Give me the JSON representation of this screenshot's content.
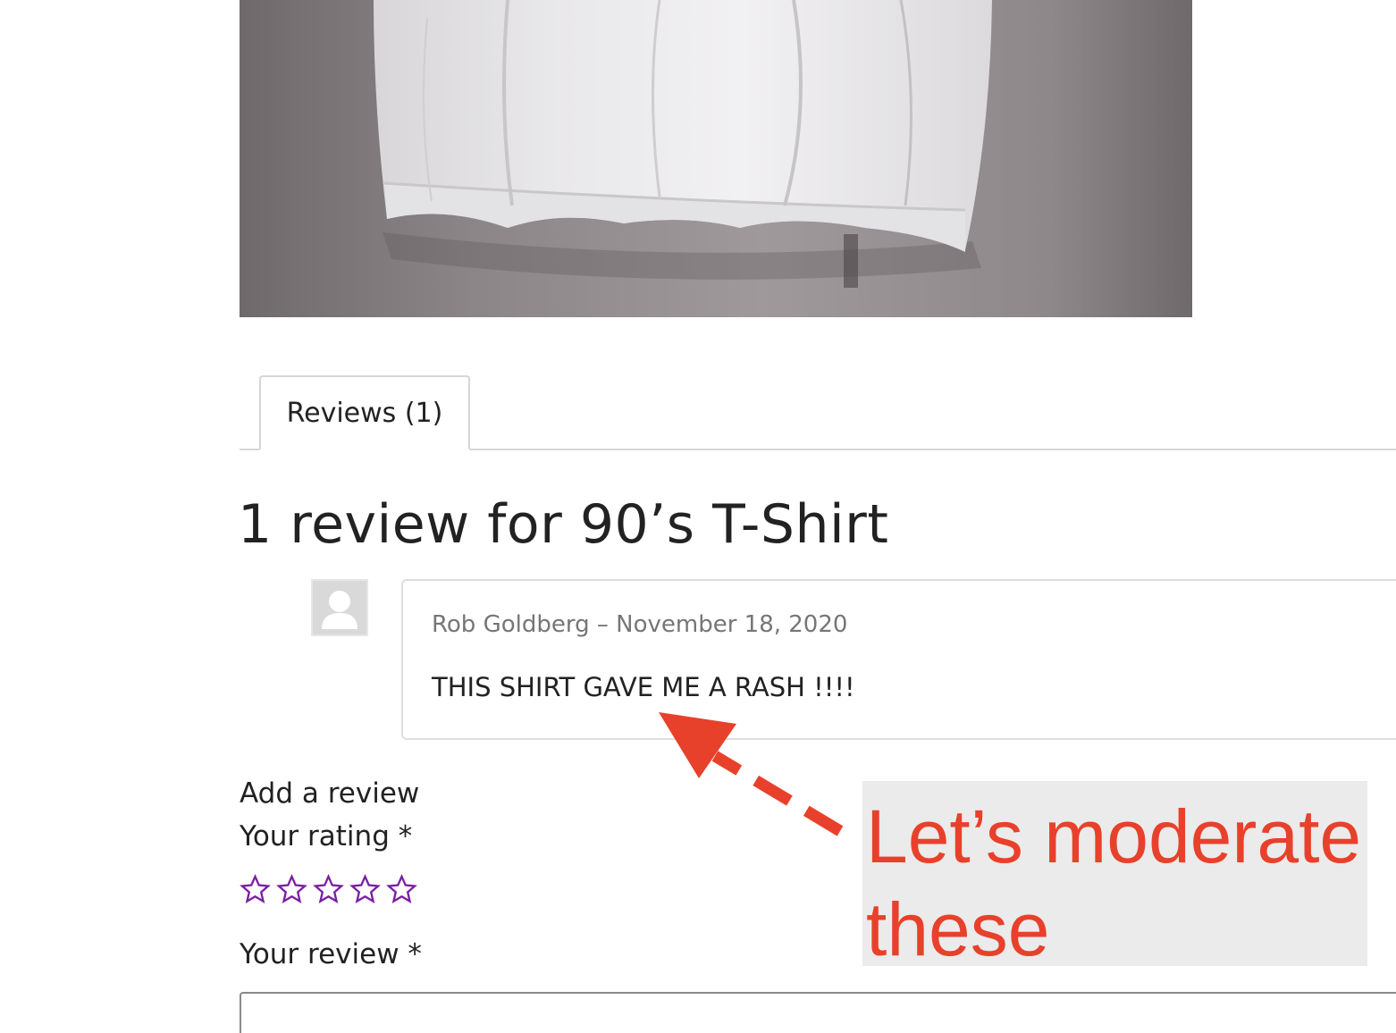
{
  "product_image": {
    "alt": "white t-shirt hanging on wall"
  },
  "tabs": [
    {
      "label": "Reviews (1)",
      "active": true
    }
  ],
  "reviews": {
    "heading": "1 review for 90’s T-Shirt",
    "items": [
      {
        "author": "Rob Goldberg",
        "separator": "–",
        "date": "November 18, 2020",
        "text": "THIS SHIRT GAVE ME A RASH !!!!",
        "avatar_icon": "user-silhouette-icon"
      }
    ]
  },
  "add_review": {
    "title": "Add a review",
    "rating_label": "Your rating *",
    "rating_max": 5,
    "rating_value": 0,
    "star_icon": "star-outline-icon",
    "review_label": "Your review *",
    "review_value": ""
  },
  "annotation": {
    "line1": "Let’s moderate",
    "line2": "these",
    "color": "#e8412b",
    "background": "#ebebeb"
  },
  "colors": {
    "text": "#222222",
    "muted": "#767676",
    "border": "#d6d6d6",
    "star": "#7a1fa2"
  }
}
